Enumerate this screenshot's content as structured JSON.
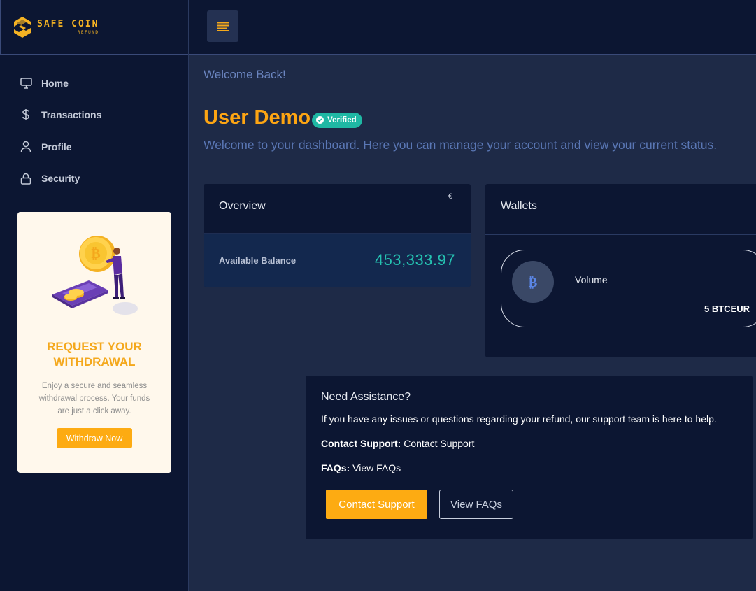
{
  "brand": {
    "name": "SAFE COIN",
    "sub": "REFUND"
  },
  "sidebar": {
    "items": [
      {
        "label": "Home",
        "icon": "monitor-icon"
      },
      {
        "label": "Transactions",
        "icon": "dollar-icon"
      },
      {
        "label": "Profile",
        "icon": "user-icon"
      },
      {
        "label": "Security",
        "icon": "lock-icon"
      }
    ]
  },
  "promo": {
    "title": "REQUEST YOUR WITHDRAWAL",
    "description": "Enjoy a secure and seamless withdrawal process. Your funds are just a click away.",
    "button": "Withdraw Now"
  },
  "header": {
    "welcome_back": "Welcome Back!",
    "user_name": "User Demo",
    "badge": "Verified",
    "description": "Welcome to your dashboard. Here you can manage your account and view your current status."
  },
  "overview": {
    "title": "Overview",
    "currency": "€",
    "balance_label": "Available Balance",
    "balance_value": "453,333.97"
  },
  "wallets": {
    "title": "Wallets",
    "coin_icon": "bitcoin-icon",
    "label": "Volume",
    "volume": "5 BTCEUR"
  },
  "assistance": {
    "title": "Need Assistance?",
    "text": "If you have any issues or questions regarding your refund, our support team is here to help.",
    "contact_label": "Contact Support:",
    "contact_value": "Contact Support",
    "faq_label": "FAQs:",
    "faq_value": "View FAQs",
    "contact_button": "Contact Support",
    "faq_button": "View FAQs"
  },
  "colors": {
    "accent": "#fdab12",
    "teal": "#25c2b1",
    "sidebar_bg": "#0c1632",
    "page_bg": "#1e2a47"
  }
}
